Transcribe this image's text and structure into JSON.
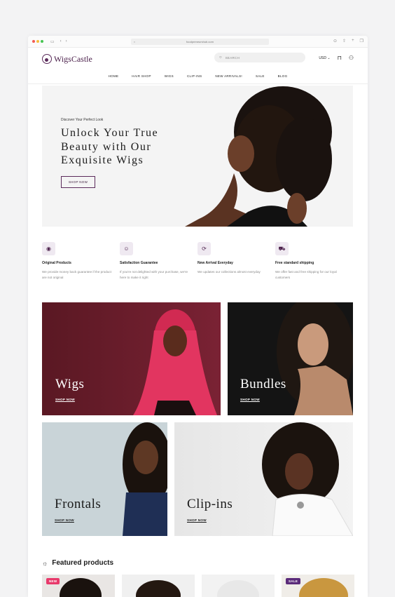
{
  "browser": {
    "url": "foodpreneurshub.com"
  },
  "header": {
    "logo_text": "WigsCastle",
    "search_placeholder": "SEARCH",
    "currency": "USD"
  },
  "nav": {
    "items": [
      "HOME",
      "HAIR SHOP",
      "WIGS",
      "CLIP-INS",
      "NEW ARRIVALS!",
      "SALE",
      "BLOG"
    ]
  },
  "hero": {
    "subtitle": "Discover Your Perfect Look",
    "title": "Unlock Your True Beauty with Our Exquisite Wigs",
    "button": "SHOP NOW"
  },
  "features": [
    {
      "icon": "check-circle-icon",
      "title": "Original Products",
      "desc": "We provide money back guarantee if the product are not original"
    },
    {
      "icon": "smile-icon",
      "title": "Satisfaction Guarantee",
      "desc": "If you're not delighted with your purchase, we're here to make it right"
    },
    {
      "icon": "refresh-icon",
      "title": "New Arrival Everyday",
      "desc": "We updates our collections almost everyday"
    },
    {
      "icon": "truck-icon",
      "title": "Free standard shipping",
      "desc": "We offer fast and free shipping for our loyal customers"
    }
  ],
  "categories": [
    {
      "title": "Wigs",
      "link": "SHOP NOW"
    },
    {
      "title": "Bundles",
      "link": "SHOP NOW"
    },
    {
      "title": "Frontals",
      "link": "SHOP NOW"
    },
    {
      "title": "Clip-ins",
      "link": "SHOP NOW"
    }
  ],
  "featured": {
    "title": "Featured products",
    "badges": [
      "NEW",
      "SALE"
    ]
  },
  "colors": {
    "brand": "#4a1f4a",
    "badge_new": "#e8396b",
    "badge_sale": "#5b2b7a"
  }
}
